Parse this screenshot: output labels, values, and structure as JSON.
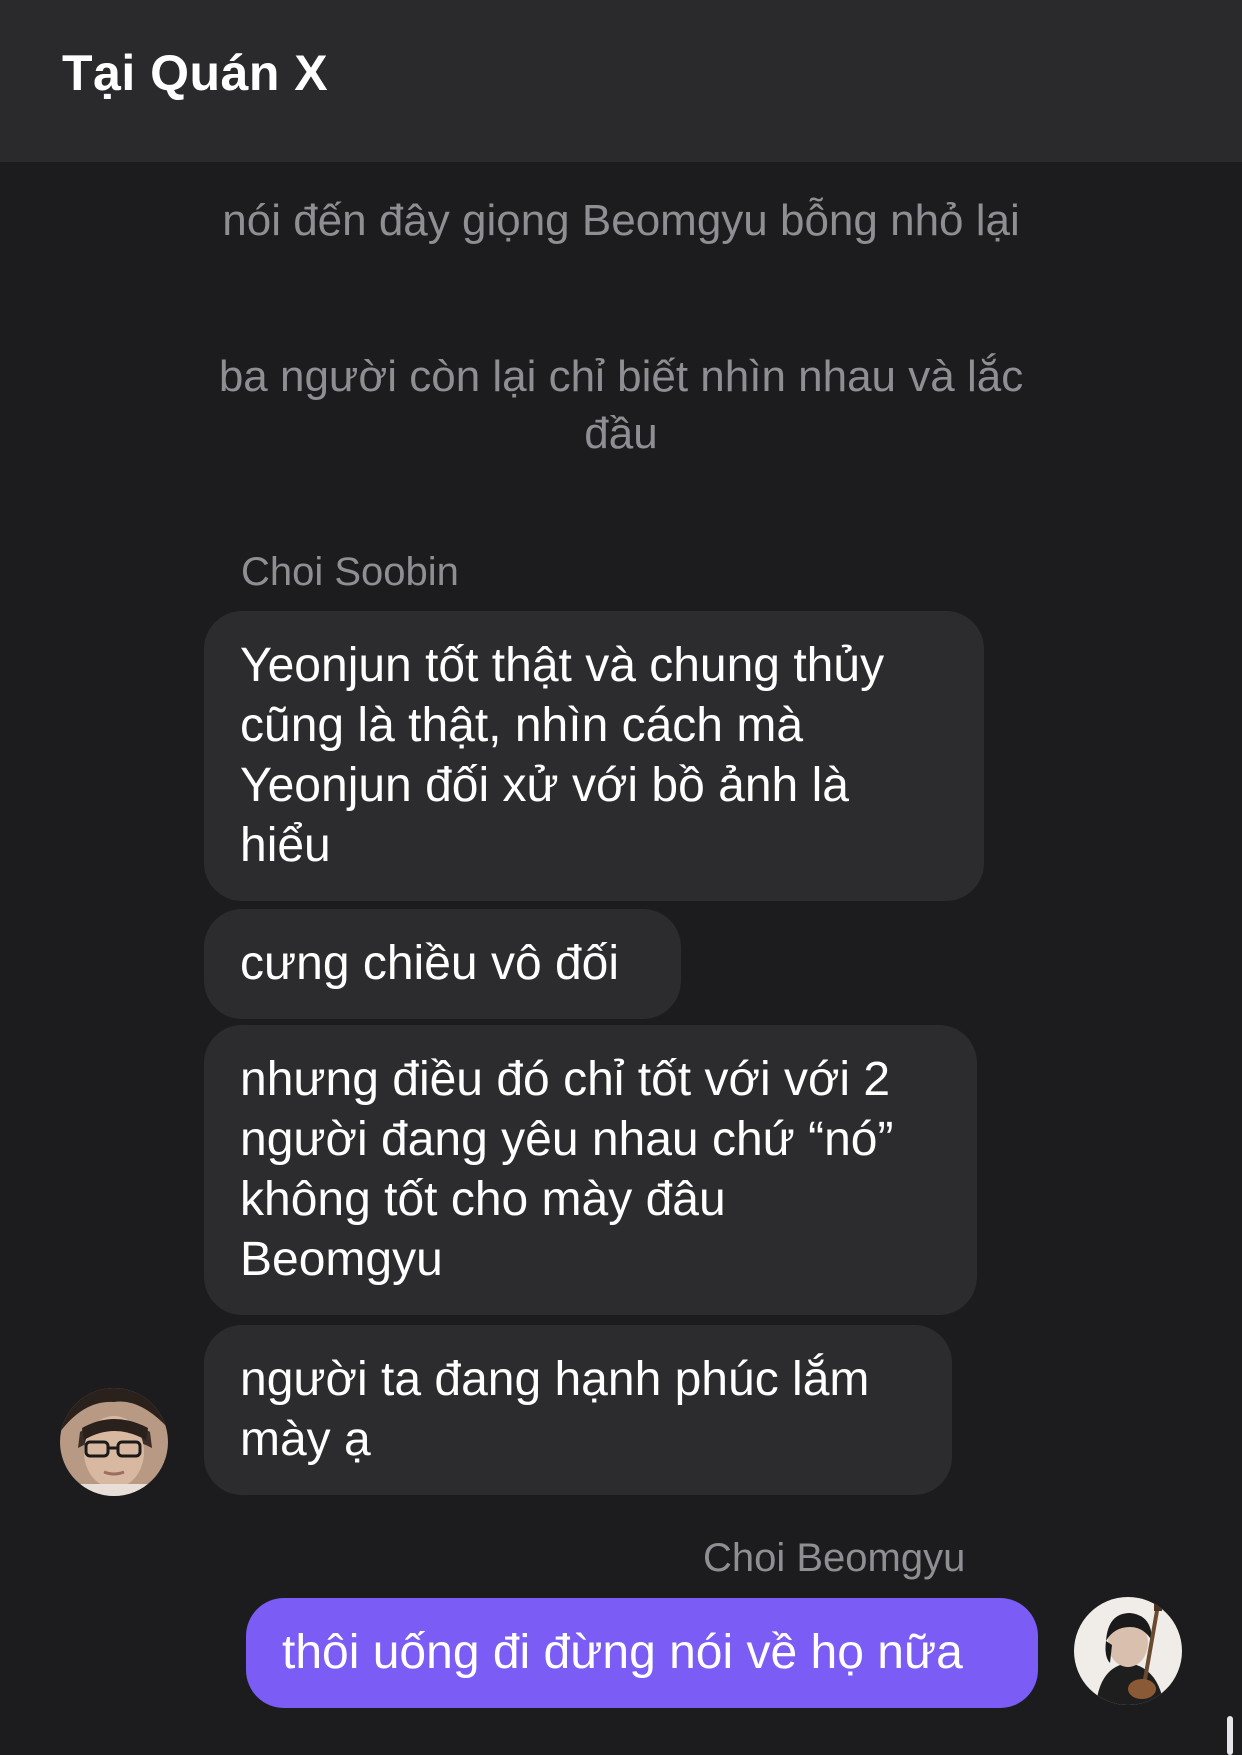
{
  "header": {
    "title": "Tại Quán X"
  },
  "narration": [
    "nói đến đây giọng Beomgyu bỗng nhỏ lại",
    "ba người còn lại chỉ biết nhìn nhau và lắc đầu"
  ],
  "messages": {
    "soobin": {
      "sender": "Choi Soobin",
      "avatar_icon": "avatar-photo-glasses",
      "bubbles": [
        "Yeonjun tốt thật và chung thủy cũng là thật, nhìn cách mà Yeonjun đối xử với bồ ảnh là hiểu",
        "cưng chiều vô đối",
        "nhưng điều đó chỉ tốt với với 2 người đang yêu nhau chứ “nó” không tốt cho mày đâu Beomgyu",
        "người ta đang hạnh phúc lắm mày ạ"
      ]
    },
    "beomgyu": {
      "sender": "Choi Beomgyu",
      "avatar_icon": "avatar-photo-guitar",
      "bubbles": [
        "thôi uống đi đừng nói về họ nữa"
      ]
    }
  },
  "colors": {
    "background": "#1c1c1e",
    "header": "#2a2a2c",
    "bubble_other": "#2c2c2e",
    "bubble_me": "#7b5cf5",
    "muted_text": "#8e8e93"
  }
}
